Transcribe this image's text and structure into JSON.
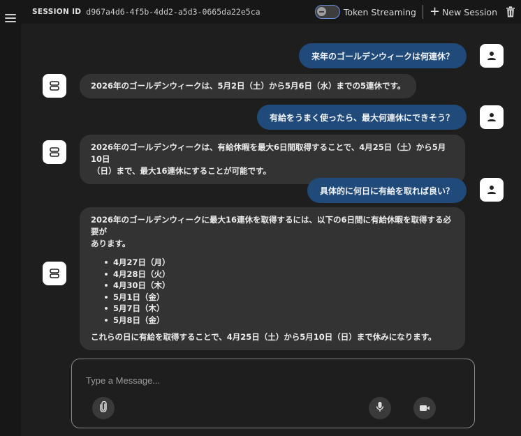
{
  "header": {
    "session_label": "SESSION ID",
    "session_id": "d967a4d6-4f5b-4dd2-a5d3-0665da22e5ca",
    "streaming_label": "Token Streaming",
    "streaming_enabled": false,
    "new_session_label": "New Session"
  },
  "messages": [
    {
      "role": "user",
      "text": "来年のゴールデンウィークは何連休？"
    },
    {
      "role": "bot",
      "text": "2026年のゴールデンウィークは、5月2日（土）から5月6日（水）までの5連休です。"
    },
    {
      "role": "user",
      "text": "有給をうまく使ったら、最大何連休にできそう？"
    },
    {
      "role": "bot",
      "line1": "2026年のゴールデンウィークは、有給休暇を最大6日間取得することで、4月25日（土）から5月10日",
      "line2": "（日）まで、最大16連休にすることが可能です。"
    },
    {
      "role": "user",
      "text": "具体的に何日に有給を取れば良い？"
    },
    {
      "role": "bot",
      "intro1": "2026年のゴールデンウィークに最大16連休を取得するには、以下の6日間に有給休暇を取得する必要が",
      "intro2": "あります。",
      "items": [
        "4月27日（月）",
        "4月28日（火）",
        "4月30日（木）",
        "5月1日（金）",
        "5月7日（木）",
        "5月8日（金）"
      ],
      "outro": "これらの日に有給を取得することで、4月25日（土）から5月10日（日）まで休みになります。"
    }
  ],
  "composer": {
    "placeholder": "Type a Message..."
  },
  "colors": {
    "user_bubble": "#1f4a7a",
    "bot_bubble": "#333333",
    "background": "#1e1e1e"
  }
}
